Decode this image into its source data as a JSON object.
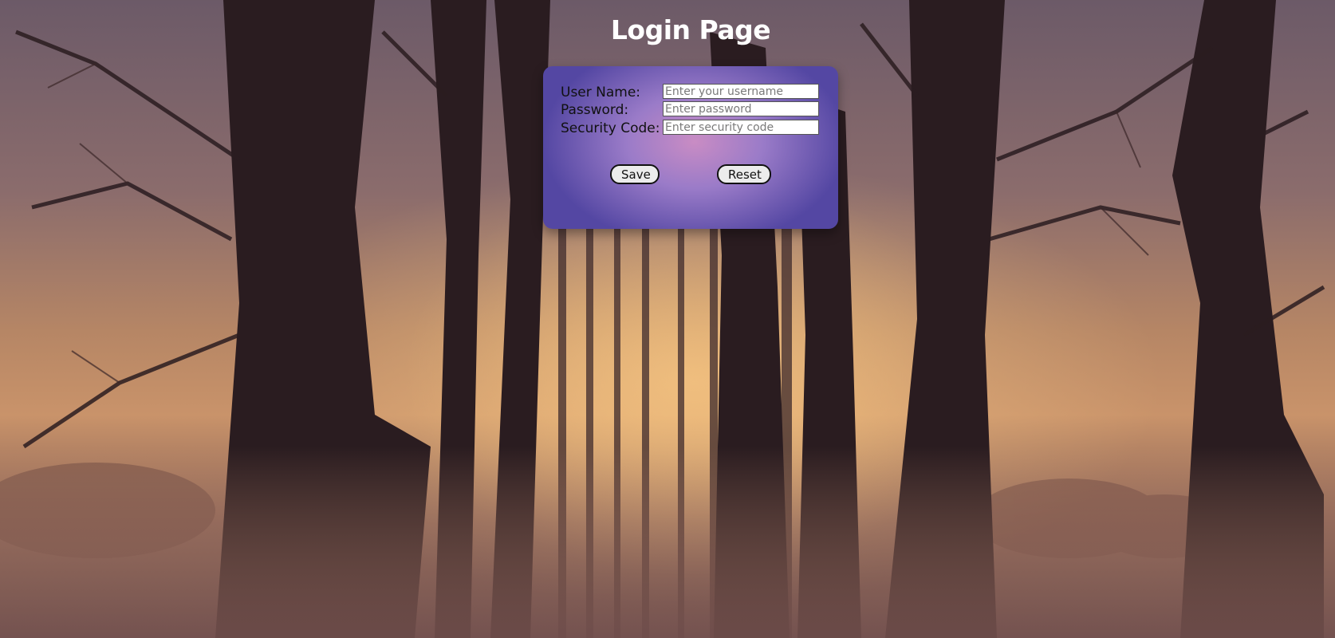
{
  "page": {
    "title": "Login Page"
  },
  "form": {
    "username": {
      "label": "User Name:",
      "placeholder": "Enter your username",
      "value": ""
    },
    "password": {
      "label": "Password:",
      "placeholder": "Enter password",
      "value": ""
    },
    "security_code": {
      "label": "Security Code:",
      "placeholder": "Enter security code",
      "value": ""
    },
    "save_label": "Save",
    "reset_label": "Reset"
  },
  "colors": {
    "panel_center": "#c98cc4",
    "panel_edge": "#5447a3",
    "title": "#ffffff"
  },
  "background": {
    "subject": "misty-tree-avenue-at-sunrise"
  }
}
